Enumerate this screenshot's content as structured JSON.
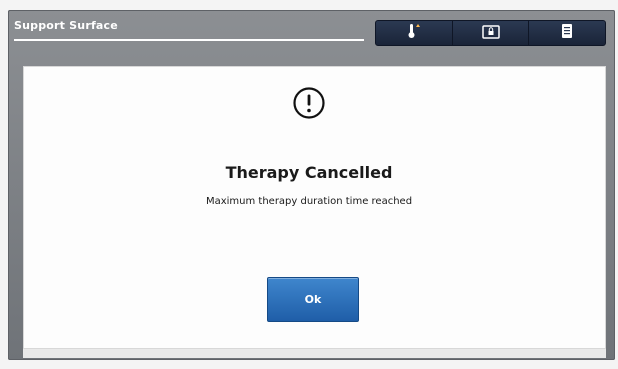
{
  "header": {
    "title": "Support Surface"
  },
  "toolbar": {
    "buttons": [
      {
        "icon": "thermometer-icon"
      },
      {
        "icon": "lock-screen-icon"
      },
      {
        "icon": "document-icon"
      }
    ]
  },
  "dialog": {
    "icon": "exclamation-circle-icon",
    "title": "Therapy Cancelled",
    "message": "Maximum therapy duration time reached",
    "ok_label": "Ok"
  },
  "colors": {
    "frame": "#7f8388",
    "toolbar_button": "#1f2b42",
    "ok_button": "#2b6fba"
  }
}
